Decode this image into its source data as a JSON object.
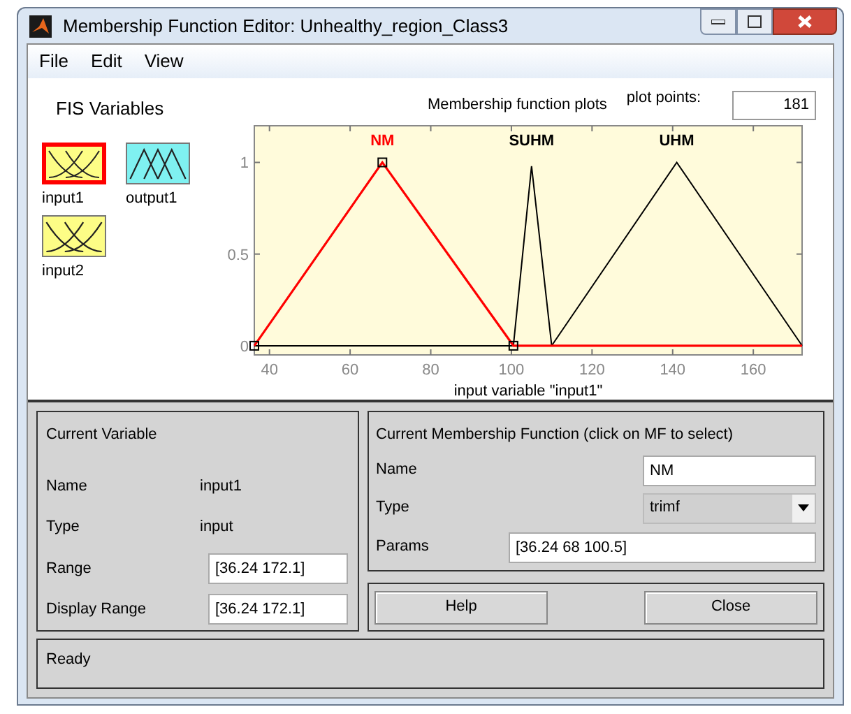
{
  "window": {
    "title": "Membership Function Editor: Unhealthy_region_Class3"
  },
  "menu": [
    "File",
    "Edit",
    "View"
  ],
  "fis_variables": {
    "title": "FIS Variables",
    "items": [
      {
        "label": "input1",
        "kind": "input",
        "selected": true
      },
      {
        "label": "output1",
        "kind": "output",
        "selected": false
      },
      {
        "label": "input2",
        "kind": "input",
        "selected": false
      }
    ]
  },
  "plot": {
    "title": "Membership function plots",
    "plot_points_label": "plot points:",
    "plot_points": "181",
    "chart_data": {
      "type": "line",
      "xlabel": "input variable \"input1\"",
      "x": [
        36.24,
        68,
        100.5,
        105,
        110,
        141,
        172.1
      ],
      "series": [
        {
          "name": "NM",
          "color": "#ff0000",
          "values": [
            0,
            1,
            0,
            0,
            0,
            0,
            0
          ]
        },
        {
          "name": "SUHM",
          "color": "#000000",
          "values": [
            null,
            null,
            0,
            0.98,
            0,
            null,
            null
          ]
        },
        {
          "name": "UHM",
          "color": "#000000",
          "values": [
            null,
            null,
            null,
            null,
            0,
            1,
            0
          ]
        }
      ],
      "xlim": [
        36.24,
        172.1
      ],
      "ylim": [
        -0.05,
        1.2
      ],
      "xticks": [
        40,
        60,
        80,
        100,
        120,
        140,
        160
      ],
      "yticks": [
        0,
        0.5,
        1
      ]
    },
    "mf_labels": [
      {
        "selected": true
      },
      {
        "selected": false
      },
      {
        "selected": false
      }
    ]
  },
  "current_variable": {
    "title": "Current Variable",
    "fields": [
      {
        "label": "Name",
        "value": "input1",
        "kind": "text"
      },
      {
        "label": "Type",
        "value": "input",
        "kind": "text"
      },
      {
        "label": "Range",
        "value": "[36.24 172.1]",
        "kind": "input"
      },
      {
        "label": "Display Range",
        "value": "[36.24 172.1]",
        "kind": "input"
      }
    ]
  },
  "current_mf": {
    "title": "Current Membership Function (click on MF to select)",
    "name_label": "Name",
    "name": "NM",
    "type_label": "Type",
    "type": "trimf",
    "params_label": "Params",
    "params": "[36.24 68 100.5]"
  },
  "buttons": [
    "Help",
    "Close"
  ],
  "status": "Ready"
}
